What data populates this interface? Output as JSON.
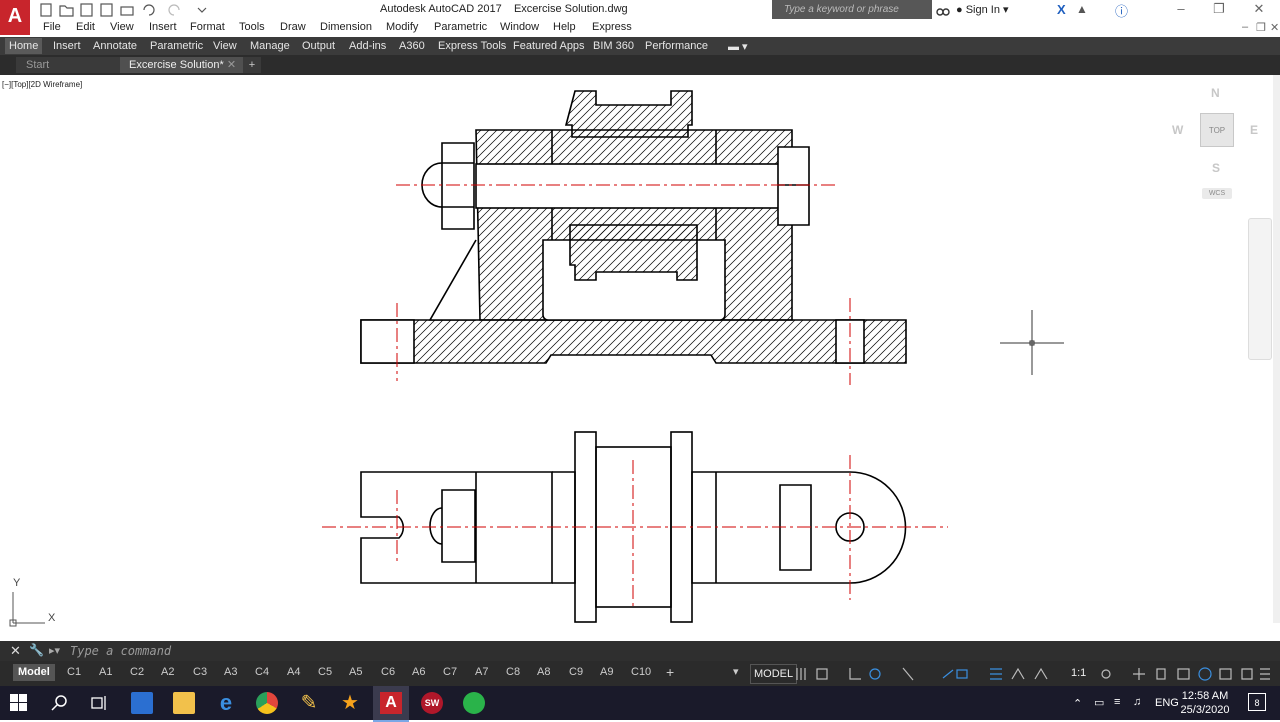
{
  "app": {
    "title": "Autodesk AutoCAD 2017",
    "document": "Excercise Solution.dwg",
    "logo_letter": "A",
    "search_placeholder": "Type a keyword or phrase",
    "sign_in": "Sign In"
  },
  "menu": [
    "File",
    "Edit",
    "View",
    "Insert",
    "Format",
    "Tools",
    "Draw",
    "Dimension",
    "Modify",
    "Parametric",
    "Window",
    "Help",
    "Express"
  ],
  "ribbon_tabs": [
    "Home",
    "Insert",
    "Annotate",
    "Parametric",
    "View",
    "Manage",
    "Output",
    "Add-ins",
    "A360",
    "Express Tools",
    "Featured Apps",
    "BIM 360",
    "Performance"
  ],
  "doc_tabs": [
    "Start",
    "Excercise Solution*"
  ],
  "viewport": {
    "label": "[−][Top][2D Wireframe]",
    "viewcube": {
      "face": "TOP",
      "n": "N",
      "s": "S",
      "e": "E",
      "w": "W",
      "wcs": "WCS"
    },
    "ucs": {
      "x": "X",
      "y": "Y"
    }
  },
  "command": {
    "placeholder": "Type a command"
  },
  "layout_tabs": [
    "Model",
    "C1",
    "A1",
    "C2",
    "A2",
    "C3",
    "A3",
    "C4",
    "A4",
    "C5",
    "A5",
    "C6",
    "A6",
    "C7",
    "A7",
    "C8",
    "A8",
    "C9",
    "A9",
    "C10"
  ],
  "status": {
    "model": "MODEL",
    "scale": "1:1"
  },
  "taskbar": {
    "lang": "ENG",
    "time": "12:58 AM",
    "date": "25/3/2020",
    "notifications": "8"
  },
  "colors": {
    "accent": "#c8252c",
    "centerline": "#d00000",
    "ribbon_bg": "#3b3b3b",
    "taskbar_bg": "#1a1a2a"
  }
}
